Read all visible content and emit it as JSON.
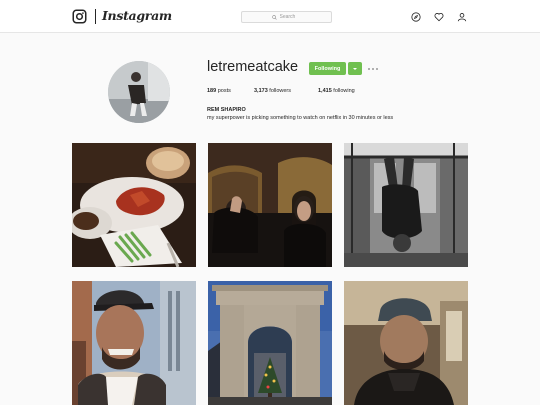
{
  "nav": {
    "wordmark": "Instagram",
    "search_placeholder": "Search",
    "icons": [
      "instagram-camera-icon",
      "search-icon",
      "explore-compass-icon",
      "heart-icon",
      "person-icon"
    ]
  },
  "profile": {
    "username": "letremeatcake",
    "follow_label": "Following",
    "posts_count": "189",
    "posts_label": "posts",
    "followers_count": "3,173",
    "followers_label": "followers",
    "following_count": "1,415",
    "following_label": "following",
    "full_name": "REM SHAPIRO",
    "bio": "my superpower is picking something to watch on netflix in 30 minutes or less"
  },
  "colors": {
    "follow_button": "#70c050",
    "background": "#fafafa"
  },
  "posts": [
    {
      "subject": "food-plates"
    },
    {
      "subject": "couple-on-couch"
    },
    {
      "subject": "subway-handstand"
    },
    {
      "subject": "selfie-street"
    },
    {
      "subject": "washington-square-arch"
    },
    {
      "subject": "selfie-subway"
    }
  ]
}
